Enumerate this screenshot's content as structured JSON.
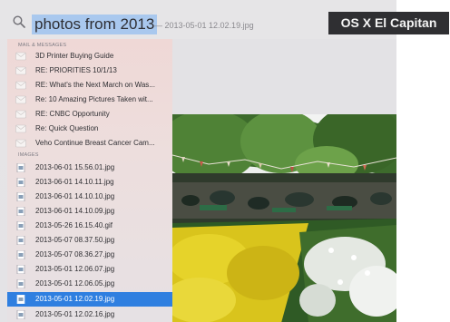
{
  "search": {
    "query": "photos from 2013",
    "suffix": "— 2013-05-01 12.02.19.jpg"
  },
  "badge": {
    "label": "OS X El Capitan"
  },
  "sections": {
    "mail": {
      "header": "MAIL & MESSAGES",
      "items": [
        {
          "label": "3D Printer Buying Guide",
          "icon": "envelope-icon"
        },
        {
          "label": "RE: PRIORITIES 10/1/13",
          "icon": "envelope-icon"
        },
        {
          "label": "RE: What's the Next March on Was...",
          "icon": "envelope-icon"
        },
        {
          "label": "Re: 10 Amazing Pictures Taken wit...",
          "icon": "envelope-icon"
        },
        {
          "label": "RE: CNBC Opportunity",
          "icon": "envelope-icon"
        },
        {
          "label": "Re: Quick Question",
          "icon": "envelope-icon"
        },
        {
          "label": "Veho Continue Breast Cancer Cam...",
          "icon": "envelope-icon"
        }
      ]
    },
    "images": {
      "header": "IMAGES",
      "items": [
        {
          "label": "2013-06-01 15.56.01.jpg",
          "icon": "image-file-icon"
        },
        {
          "label": "2013-06-01 14.10.11.jpg",
          "icon": "image-file-icon"
        },
        {
          "label": "2013-06-01 14.10.10.jpg",
          "icon": "image-file-icon"
        },
        {
          "label": "2013-06-01 14.10.09.jpg",
          "icon": "image-file-icon"
        },
        {
          "label": "2013-05-26 16.15.40.gif",
          "icon": "image-file-icon"
        },
        {
          "label": "2013-05-07 08.37.50.jpg",
          "icon": "image-file-icon"
        },
        {
          "label": "2013-05-07 08.36.27.jpg",
          "icon": "image-file-icon"
        },
        {
          "label": "2013-05-01 12.06.07.jpg",
          "icon": "image-file-icon"
        },
        {
          "label": "2013-05-01 12.06.05.jpg",
          "icon": "image-file-icon"
        },
        {
          "label": "2013-05-01 12.02.19.jpg",
          "icon": "image-file-icon",
          "selected": true
        },
        {
          "label": "2013-05-01 12.02.16.jpg",
          "icon": "image-file-icon"
        }
      ]
    }
  },
  "colors": {
    "selection": "#2f7fe0",
    "query_highlight": "#a9c8ee",
    "badge_background": "#2f2f32"
  }
}
